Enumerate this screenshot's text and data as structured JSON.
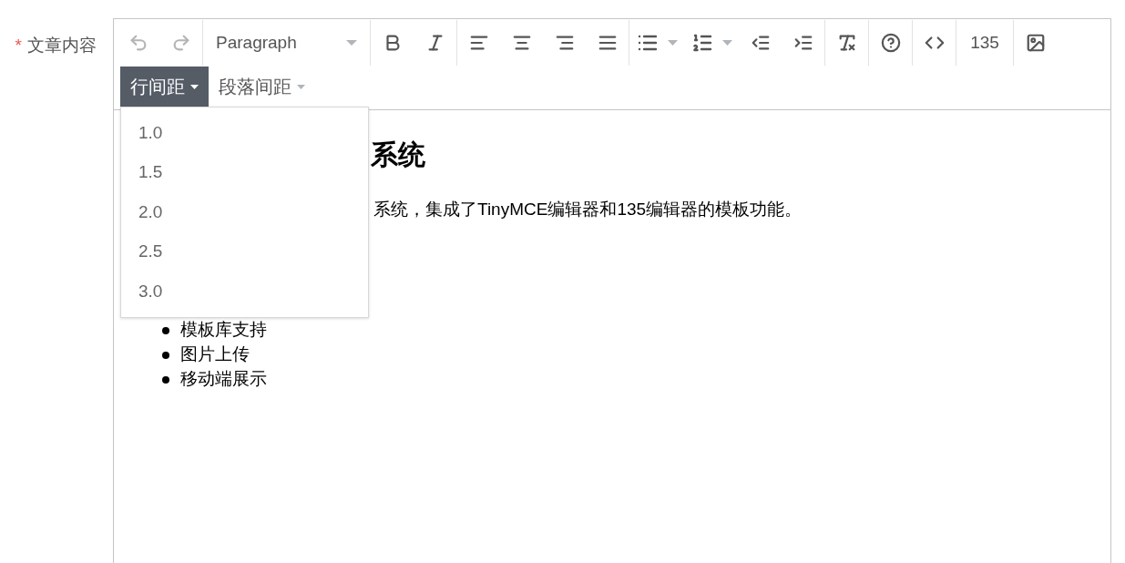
{
  "field": {
    "required_mark": "*",
    "label": "文章内容"
  },
  "toolbar": [
    {
      "items": [
        {
          "kind": "icon",
          "disabled": true
        },
        {
          "kind": "icon",
          "disabled": true
        }
      ]
    },
    {
      "items": [
        {
          "kind": "select",
          "text": "Paragraph"
        }
      ]
    },
    {
      "items": [
        {
          "kind": "icon",
          "disabled": false
        },
        {
          "kind": "icon",
          "disabled": false
        }
      ]
    },
    {
      "items": [
        {
          "kind": "icon",
          "disabled": false
        },
        {
          "kind": "icon",
          "disabled": false
        },
        {
          "kind": "icon",
          "disabled": false
        },
        {
          "kind": "icon",
          "disabled": false
        }
      ]
    },
    {
      "items": [
        {
          "kind": "split",
          "disabled": false
        },
        {
          "kind": "split",
          "disabled": false
        },
        {
          "kind": "icon",
          "disabled": false
        },
        {
          "kind": "icon",
          "disabled": false
        }
      ]
    },
    {
      "items": [
        {
          "kind": "icon",
          "disabled": false
        }
      ]
    },
    {
      "items": [
        {
          "kind": "icon",
          "disabled": false
        }
      ]
    },
    {
      "items": [
        {
          "kind": "icon",
          "disabled": false
        }
      ]
    },
    {
      "items": [
        {
          "kind": "text",
          "text": "135"
        }
      ]
    },
    {
      "items": [
        {
          "kind": "icon",
          "disabled": false
        }
      ]
    }
  ],
  "menubar": [
    {
      "label": "行间距",
      "selected": true
    },
    {
      "label": "段落间距",
      "selected": false
    }
  ],
  "dropdown": {
    "items": [
      "1.0",
      "1.5",
      "2.0",
      "2.5",
      "3.0"
    ]
  },
  "content": {
    "heading": "系统",
    "paragraph": "系统，集成了TinyMCE编辑器和135编辑器的模板功能。",
    "list": [
      "模板库支持",
      "图片上传",
      "移动端展示"
    ]
  }
}
